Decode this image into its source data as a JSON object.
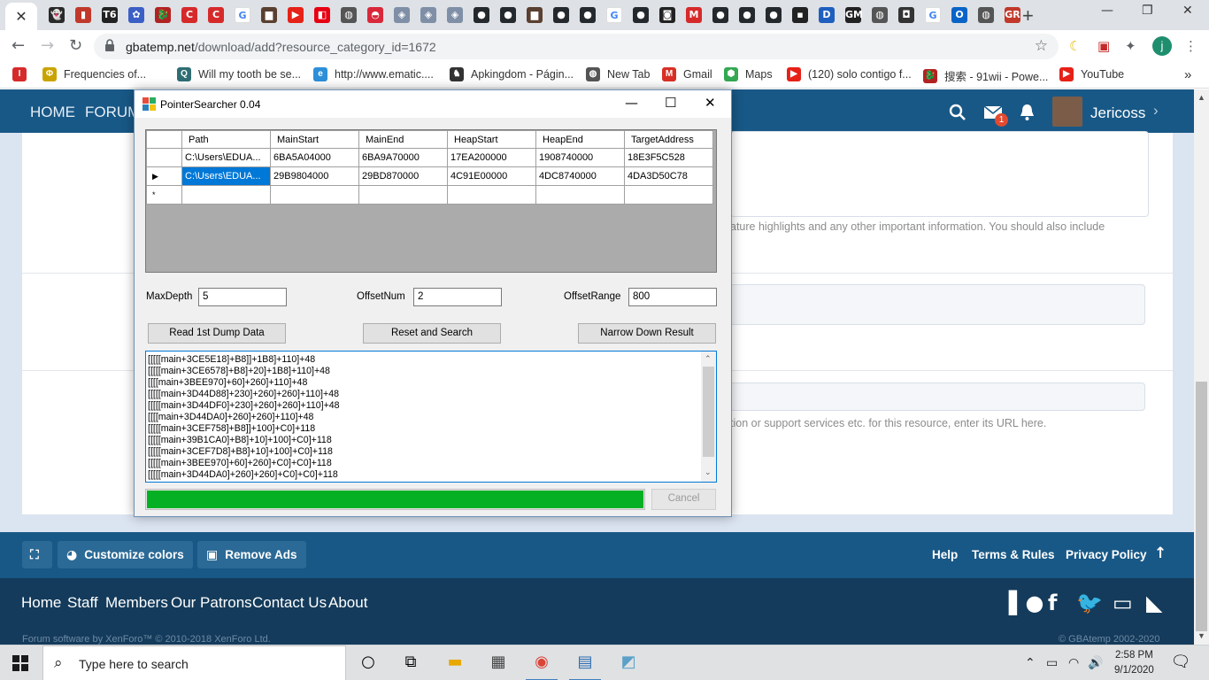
{
  "browser": {
    "tabs": [
      {
        "icon": "ghost-icon",
        "glyph": "👻",
        "color": "#2a2a2a"
      },
      {
        "icon": "red-app-icon",
        "glyph": "▮",
        "color": "#c0392b"
      },
      {
        "icon": "t6-icon",
        "glyph": "T6",
        "color": "#222"
      },
      {
        "icon": "flower-icon",
        "glyph": "✿",
        "color": "#3b5fc6"
      },
      {
        "icon": "dragon-icon",
        "glyph": "🐉",
        "color": "#b22222"
      },
      {
        "icon": "c-red-icon",
        "glyph": "C",
        "color": "#d62a2a"
      },
      {
        "icon": "c-red-icon",
        "glyph": "C",
        "color": "#d62a2a"
      },
      {
        "icon": "google-icon",
        "glyph": "G",
        "color": "#fff"
      },
      {
        "icon": "game-box-icon",
        "glyph": "▆",
        "color": "#5a4030"
      },
      {
        "icon": "youtube-icon",
        "glyph": "▶",
        "color": "#e62117"
      },
      {
        "icon": "switch-icon",
        "glyph": "◧",
        "color": "#e60012"
      },
      {
        "icon": "globe-icon",
        "glyph": "◍",
        "color": "#555"
      },
      {
        "icon": "pokeball-icon",
        "glyph": "◓",
        "color": "#d8283a"
      },
      {
        "icon": "gbatemp-icon",
        "glyph": "◈",
        "color": "#7f8fa6"
      },
      {
        "icon": "gbatemp-icon",
        "glyph": "◈",
        "color": "#7f8fa6"
      },
      {
        "icon": "gbatemp-icon",
        "glyph": "◈",
        "color": "#7f8fa6"
      },
      {
        "icon": "github-icon",
        "glyph": "●",
        "color": "#24292e"
      },
      {
        "icon": "github-icon",
        "glyph": "●",
        "color": "#24292e"
      },
      {
        "icon": "game-box-icon",
        "glyph": "▆",
        "color": "#5a4030"
      },
      {
        "icon": "github-icon",
        "glyph": "●",
        "color": "#24292e"
      },
      {
        "icon": "github-icon",
        "glyph": "●",
        "color": "#24292e"
      },
      {
        "icon": "google-icon",
        "glyph": "G",
        "color": "#fff"
      },
      {
        "icon": "github-icon",
        "glyph": "●",
        "color": "#24292e"
      },
      {
        "icon": "cartoon-icon",
        "glyph": "◙",
        "color": "#222"
      },
      {
        "icon": "m-red-icon",
        "glyph": "M",
        "color": "#d62a2a"
      },
      {
        "icon": "github-icon",
        "glyph": "●",
        "color": "#24292e"
      },
      {
        "icon": "github-icon",
        "glyph": "●",
        "color": "#24292e"
      },
      {
        "icon": "github-icon",
        "glyph": "●",
        "color": "#24292e"
      },
      {
        "icon": "terminal-icon",
        "glyph": "▪",
        "color": "#222"
      },
      {
        "icon": "dpt-icon",
        "glyph": "D",
        "color": "#1f5fbf"
      },
      {
        "icon": "gm-icon",
        "glyph": "GM",
        "color": "#222"
      },
      {
        "icon": "globe-icon",
        "glyph": "◍",
        "color": "#555"
      },
      {
        "icon": "monster-icon",
        "glyph": "◘",
        "color": "#333"
      },
      {
        "icon": "google-icon",
        "glyph": "G",
        "color": "#fff"
      },
      {
        "icon": "outlook-icon",
        "glyph": "O",
        "color": "#0a64c8"
      },
      {
        "icon": "globe-icon",
        "glyph": "◍",
        "color": "#555"
      },
      {
        "icon": "gr-icon",
        "glyph": "GR",
        "color": "#c0392b"
      }
    ],
    "new_tab": "+",
    "url_host": "gbatemp.net",
    "url_path": "/download/add?resource_category_id=1672",
    "profile_initial": "j",
    "bookmarks": [
      {
        "label": "",
        "icon": "i-red-icon",
        "glyph": "I",
        "color": "#d62a2a"
      },
      {
        "label": "Frequencies of...",
        "icon": "phy-icon",
        "glyph": "Φ",
        "color": "#c9a400"
      },
      {
        "label": "Will my tooth be se...",
        "icon": "search-q-icon",
        "glyph": "Q",
        "color": "#2e6e73"
      },
      {
        "label": "http://www.ematic....",
        "icon": "ematic-icon",
        "glyph": "e",
        "color": "#2d8fd9"
      },
      {
        "label": "Apkingdom - Págin...",
        "icon": "apkingdom-icon",
        "glyph": "♞",
        "color": "#333"
      },
      {
        "label": "New Tab",
        "icon": "globe-icon",
        "glyph": "◍",
        "color": "#555"
      },
      {
        "label": "Gmail",
        "icon": "gmail-icon",
        "glyph": "M",
        "color": "#d93025"
      },
      {
        "label": "Maps",
        "icon": "maps-icon",
        "glyph": "⬢",
        "color": "#34a853"
      },
      {
        "label": "(120) solo contigo f...",
        "icon": "youtube-icon",
        "glyph": "▶",
        "color": "#e62117"
      },
      {
        "label": "搜索 - 91wii - Powe...",
        "icon": "dragon-icon",
        "glyph": "🐉",
        "color": "#b22222"
      },
      {
        "label": "YouTube",
        "icon": "youtube-icon",
        "glyph": "▶",
        "color": "#e62117"
      }
    ],
    "more": "»"
  },
  "site": {
    "nav": {
      "home": "HOME",
      "forums": "FORUMS",
      "notif_count": "1",
      "username": "Jericoss"
    },
    "hint1": "ature highlights and any other important information. You should also include",
    "hint2": "tion or support services etc. for this resource, enter its URL here.",
    "footer_buttons": {
      "customize": "Customize colors",
      "remove_ads": "Remove Ads"
    },
    "footer_links": {
      "help": "Help",
      "terms": "Terms & Rules",
      "privacy": "Privacy Policy"
    },
    "footer2_links": [
      "Home",
      "Staff",
      "Members",
      "Our Patrons",
      "Contact Us",
      "About"
    ],
    "copyright_left": "Forum software by XenForo™ © 2010-2018 XenForo Ltd.",
    "copyright_right": "© GBAtemp 2002-2020"
  },
  "app": {
    "title": "PointerSearcher 0.04",
    "columns": [
      "Path",
      "MainStart",
      "MainEnd",
      "HeapStart",
      "HeapEnd",
      "TargetAddress"
    ],
    "rows": [
      {
        "marker": "",
        "cells": [
          "C:\\Users\\EDUA...",
          "6BA5A04000",
          "6BA9A70000",
          "17EA200000",
          "1908740000",
          "18E3F5C528"
        ]
      },
      {
        "marker": "▶",
        "cells": [
          "C:\\Users\\EDUA...",
          "29B9804000",
          "29BD870000",
          "4C91E00000",
          "4DC8740000",
          "4DA3D50C78"
        ]
      },
      {
        "marker": "*",
        "cells": [
          "",
          "",
          "",
          "",
          "",
          ""
        ]
      }
    ],
    "max_depth_label": "MaxDepth",
    "max_depth": "5",
    "offset_num_label": "OffsetNum",
    "offset_num": "2",
    "offset_range_label": "OffsetRange",
    "offset_range": "800",
    "btn_read": "Read 1st Dump Data",
    "btn_reset": "Reset and Search",
    "btn_narrow": "Narrow Down Result",
    "btn_cancel": "Cancel",
    "progress": 1.0,
    "results": [
      "[[[[[main+3CE5E18]+B8]]+1B8]+110]+48",
      "[[[[[main+3CE6578]+B8]+20]+1B8]+110]+48",
      "[[[[main+3BEE970]+60]+260]+110]+48",
      "[[[[[main+3D44D88]+230]+260]+260]+110]+48",
      "[[[[[main+3D44DF0]+230]+260]+260]+110]+48",
      "[[[[main+3D44DA0]+260]+260]+110]+48",
      "[[[[[main+3CEF758]+B8]]+100]+C0]+118",
      "[[[[[main+39B1CA0]+B8]+10]+100]+C0]+118",
      "[[[[[main+3CEF7D8]+B8]+10]+100]+C0]+118",
      "[[[[[main+3BEE970]+60]+260]+C0]+C0]+118",
      "[[[[[main+3D44DA0]+260]+260]+C0]+C0]+118"
    ]
  },
  "taskbar": {
    "search_placeholder": "Type here to search",
    "time": "2:58 PM",
    "date": "9/1/2020"
  }
}
